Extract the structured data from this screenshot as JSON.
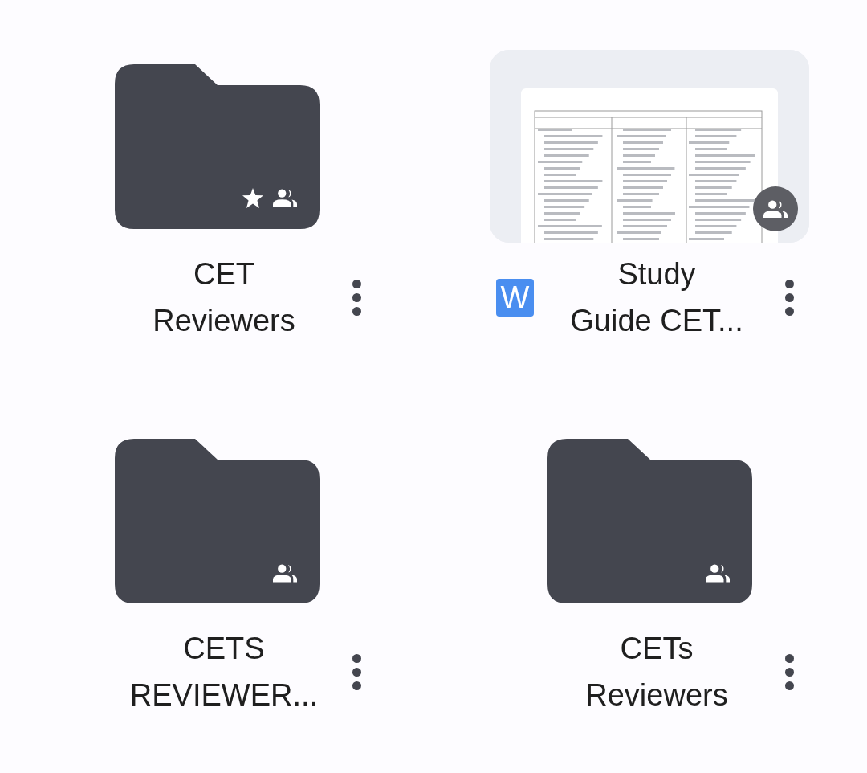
{
  "items": [
    {
      "kind": "folder",
      "name_lines": [
        "CET",
        "Reviewers"
      ],
      "starred": true,
      "shared": true
    },
    {
      "kind": "file",
      "name_lines": [
        "Study",
        "Guide CET..."
      ],
      "type_badge": "W",
      "shared": true
    },
    {
      "kind": "folder",
      "name_lines": [
        "CETS",
        "REVIEWER..."
      ],
      "starred": false,
      "shared": true
    },
    {
      "kind": "folder",
      "name_lines": [
        "CETs",
        "Reviewers"
      ],
      "starred": false,
      "shared": true
    }
  ]
}
